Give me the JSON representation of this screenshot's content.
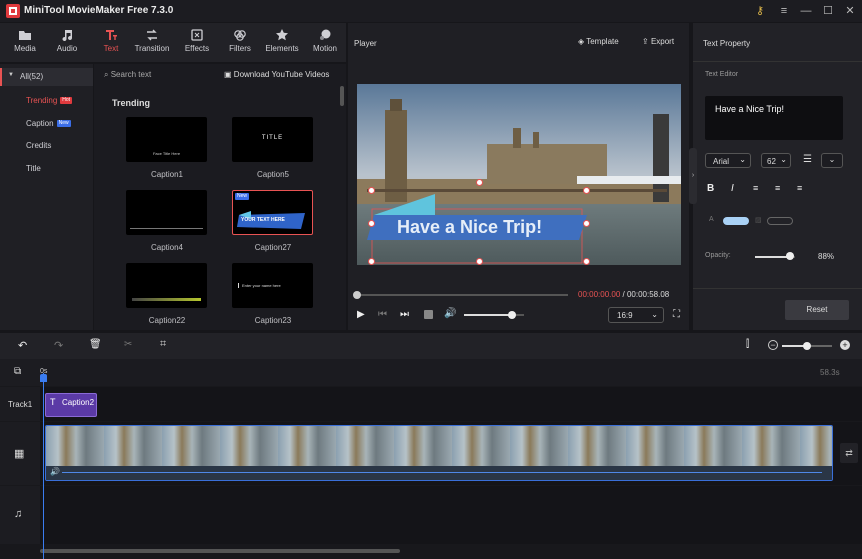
{
  "app": {
    "title": "MiniTool MovieMaker Free 7.3.0"
  },
  "toolbar": {
    "items": [
      {
        "label": "Media",
        "icon": "folder-icon"
      },
      {
        "label": "Audio",
        "icon": "music-note-icon"
      },
      {
        "label": "Text",
        "icon": "text-icon",
        "active": true
      },
      {
        "label": "Transition",
        "icon": "transition-icon"
      },
      {
        "label": "Effects",
        "icon": "effects-icon"
      },
      {
        "label": "Filters",
        "icon": "filters-icon"
      },
      {
        "label": "Elements",
        "icon": "elements-icon"
      },
      {
        "label": "Motion",
        "icon": "motion-icon"
      }
    ]
  },
  "categories": {
    "all_label": "All(52)",
    "items": [
      {
        "label": "Trending",
        "badge": "Hot",
        "active": true
      },
      {
        "label": "Caption",
        "badge": "New"
      },
      {
        "label": "Credits"
      },
      {
        "label": "Title"
      }
    ]
  },
  "library": {
    "search_placeholder": "Search text",
    "download_label": "Download YouTube Videos",
    "section_title": "Trending",
    "thumbs": [
      {
        "name": "Caption1",
        "inner": "Face  Title Here"
      },
      {
        "name": "Caption5",
        "inner": "TITLE"
      },
      {
        "name": "Caption4",
        "inner": ""
      },
      {
        "name": "Caption27",
        "inner": "YOUR TEXT HERE",
        "badge": "New"
      },
      {
        "name": "Caption22",
        "inner": ""
      },
      {
        "name": "Caption23",
        "inner": "Enter your name here"
      }
    ]
  },
  "player": {
    "title": "Player",
    "template_label": "Template",
    "export_label": "Export",
    "overlay_text": "Have a Nice Trip!",
    "current_time": "00:00:00.00",
    "separator": "/",
    "total_time": "00:00:58.08",
    "aspect_ratio": "16:9",
    "progress_fraction": 0.0,
    "volume_fraction": 0.8
  },
  "text_property": {
    "title": "Text Property",
    "editor_label": "Text Editor",
    "editor_text": "Have a Nice Trip!",
    "font": "Arial",
    "size": "62",
    "opacity_label": "Opacity:",
    "opacity_value": "88%",
    "opacity_fraction": 0.88,
    "reset_label": "Reset",
    "colors": {
      "text": "#a9d1f5",
      "accent": "#e85353"
    }
  },
  "timeline": {
    "start_label": "0s",
    "end_label": "58.3s",
    "track_label": "Track1",
    "clip_label": "Caption2",
    "zoom_fraction": 0.5
  }
}
